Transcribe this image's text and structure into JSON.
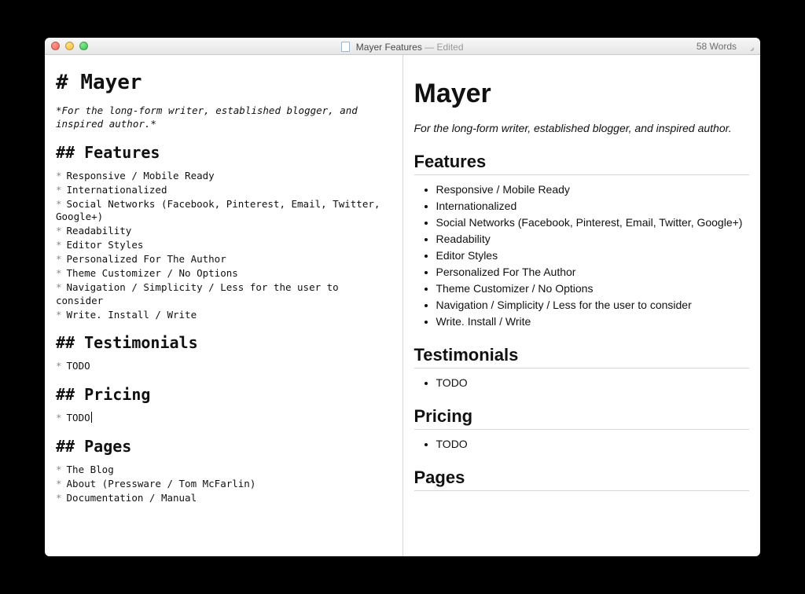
{
  "window": {
    "title_doc": "Mayer Features",
    "title_status": "— Edited",
    "word_count": "58 Words"
  },
  "doc": {
    "h1": "Mayer",
    "tagline": "For the long-form writer, established blogger, and inspired author.",
    "sections": {
      "features": {
        "heading": "Features",
        "items": [
          "Responsive / Mobile Ready",
          "Internationalized",
          "Social Networks (Facebook, Pinterest, Email, Twitter, Google+)",
          "Readability",
          "Editor Styles",
          "Personalized For The Author",
          "Theme Customizer / No Options",
          "Navigation / Simplicity / Less for the user to consider",
          "Write. Install / Write"
        ]
      },
      "testimonials": {
        "heading": "Testimonials",
        "items": [
          "TODO"
        ]
      },
      "pricing": {
        "heading": "Pricing",
        "items": [
          "TODO"
        ]
      },
      "pages": {
        "heading": "Pages",
        "items": [
          "The Blog",
          "About (Pressware / Tom McFarlin)",
          "Documentation / Manual"
        ]
      }
    }
  },
  "src": {
    "h1_prefix": "# ",
    "h2_prefix": "## ",
    "tagline_wrapped": "*For the long-form writer, established blogger, and inspired author.*",
    "bullet_prefix": "*"
  }
}
